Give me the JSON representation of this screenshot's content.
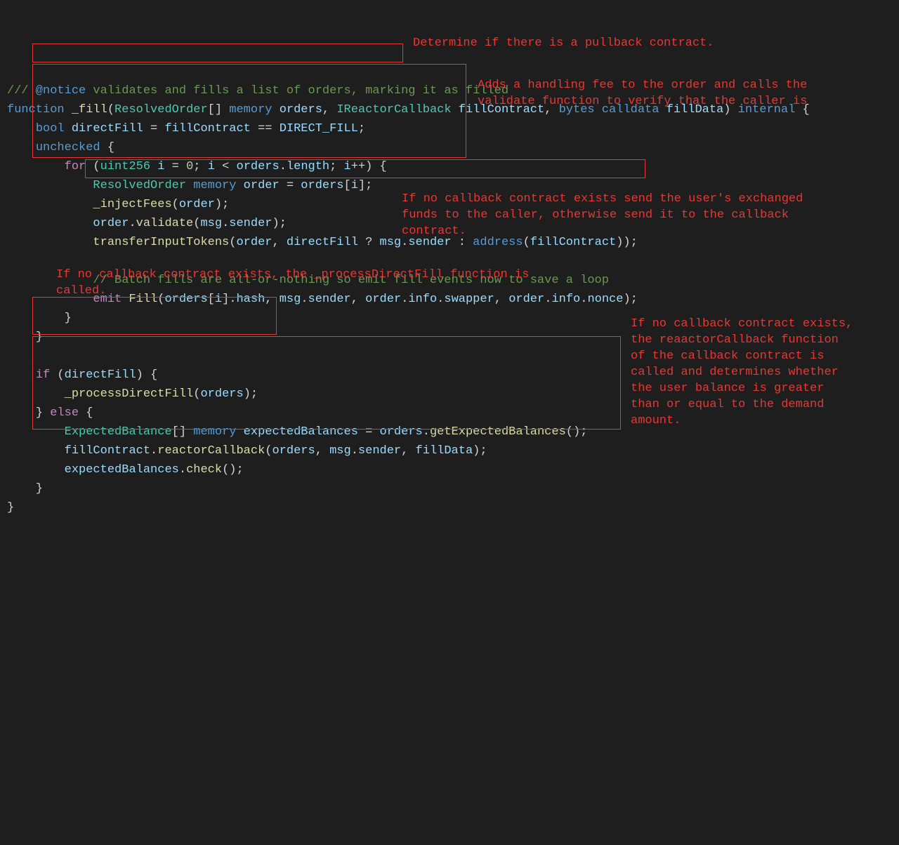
{
  "code": {
    "l1_a": "///",
    "l1_b": " @notice",
    "l1_c": " validates and fills a list of orders, marking it as filled",
    "l2_a": "function",
    "l2_b": " _fill",
    "l2_c": "(",
    "l2_d": "ResolvedOrder",
    "l2_e": "[]",
    "l2_f": " memory",
    "l2_g": " orders",
    "l2_h": ", ",
    "l2_i": "IReactorCallback",
    "l2_j": " fillContract",
    "l2_k": ", ",
    "l2_l": "bytes",
    "l2_m": " calldata",
    "l2_n": " fillData",
    "l2_o": ") ",
    "l2_p": "internal",
    "l2_q": " {",
    "l3_a": "    ",
    "l3_b": "bool",
    "l3_c": " directFill",
    "l3_d": " = ",
    "l3_e": "fillContract",
    "l3_f": " == ",
    "l3_g": "DIRECT_FILL",
    "l3_h": ";",
    "l4_a": "    ",
    "l4_b": "unchecked",
    "l4_c": " {",
    "l5_a": "        ",
    "l5_b": "for",
    "l5_c": " (",
    "l5_d": "uint256",
    "l5_e": " i",
    "l5_f": " = ",
    "l5_g": "0",
    "l5_h": "; ",
    "l5_i": "i",
    "l5_j": " < ",
    "l5_k": "orders",
    "l5_l": ".",
    "l5_m": "length",
    "l5_n": "; ",
    "l5_o": "i",
    "l5_p": "++) {",
    "l6_a": "            ",
    "l6_b": "ResolvedOrder",
    "l6_c": " memory",
    "l6_d": " order",
    "l6_e": " = ",
    "l6_f": "orders",
    "l6_g": "[",
    "l6_h": "i",
    "l6_i": "];",
    "l7_a": "            ",
    "l7_b": "_injectFees",
    "l7_c": "(",
    "l7_d": "order",
    "l7_e": ");",
    "l8_a": "            ",
    "l8_b": "order",
    "l8_c": ".",
    "l8_d": "validate",
    "l8_e": "(",
    "l8_f": "msg",
    "l8_g": ".",
    "l8_h": "sender",
    "l8_i": ");",
    "l9_a": "            ",
    "l9_b": "transferInputTokens",
    "l9_c": "(",
    "l9_d": "order",
    "l9_e": ", ",
    "l9_f": "directFill",
    "l9_g": " ? ",
    "l9_h": "msg",
    "l9_i": ".",
    "l9_j": "sender",
    "l9_k": " : ",
    "l9_l": "address",
    "l9_m": "(",
    "l9_n": "fillContract",
    "l9_o": "));",
    "l10_a": "            ",
    "l10_b": "// Batch fills are all-or-nothing so emit fill events now to save a loop",
    "l11_a": "            ",
    "l11_b": "emit",
    "l11_c": " Fill",
    "l11_d": "(",
    "l11_e": "orders",
    "l11_f": "[",
    "l11_g": "i",
    "l11_h": "].",
    "l11_i": "hash",
    "l11_j": ", ",
    "l11_k": "msg",
    "l11_l": ".",
    "l11_m": "sender",
    "l11_n": ", ",
    "l11_o": "order",
    "l11_p": ".",
    "l11_q": "info",
    "l11_r": ".",
    "l11_s": "swapper",
    "l11_t": ", ",
    "l11_u": "order",
    "l11_v": ".",
    "l11_w": "info",
    "l11_x": ".",
    "l11_y": "nonce",
    "l11_z": ");",
    "l12_a": "        }",
    "l13_a": "    }",
    "l15_a": "    ",
    "l15_b": "if",
    "l15_c": " (",
    "l15_d": "directFill",
    "l15_e": ") {",
    "l16_a": "        ",
    "l16_b": "_processDirectFill",
    "l16_c": "(",
    "l16_d": "orders",
    "l16_e": ");",
    "l17_a": "    } ",
    "l17_b": "else",
    "l17_c": " {",
    "l18_a": "        ",
    "l18_b": "ExpectedBalance",
    "l18_c": "[]",
    "l18_d": " memory",
    "l18_e": " expectedBalances",
    "l18_f": " = ",
    "l18_g": "orders",
    "l18_h": ".",
    "l18_i": "getExpectedBalances",
    "l18_j": "();",
    "l19_a": "        ",
    "l19_b": "fillContract",
    "l19_c": ".",
    "l19_d": "reactorCallback",
    "l19_e": "(",
    "l19_f": "orders",
    "l19_g": ", ",
    "l19_h": "msg",
    "l19_i": ".",
    "l19_j": "sender",
    "l19_k": ", ",
    "l19_l": "fillData",
    "l19_m": ");",
    "l20_a": "        ",
    "l20_b": "expectedBalances",
    "l20_c": ".",
    "l20_d": "check",
    "l20_e": "();",
    "l21_a": "    }",
    "l22_a": "}"
  },
  "ann": {
    "a1": "Determine if there is a pullback contract.",
    "a2": "Adds a handling fee to the order and calls the validate function to verify that the caller is",
    "a3": "If no callback contract exists send the user's exchanged funds to the caller, otherwise send it to the callback contract.",
    "a4": "If no callback contract exists, the _processDirectFill function is called.",
    "a5": "If no callback contract exists, the reaactorCallback function of the callback contract is called and determines whether the user balance is greater than or equal to the demand amount."
  }
}
